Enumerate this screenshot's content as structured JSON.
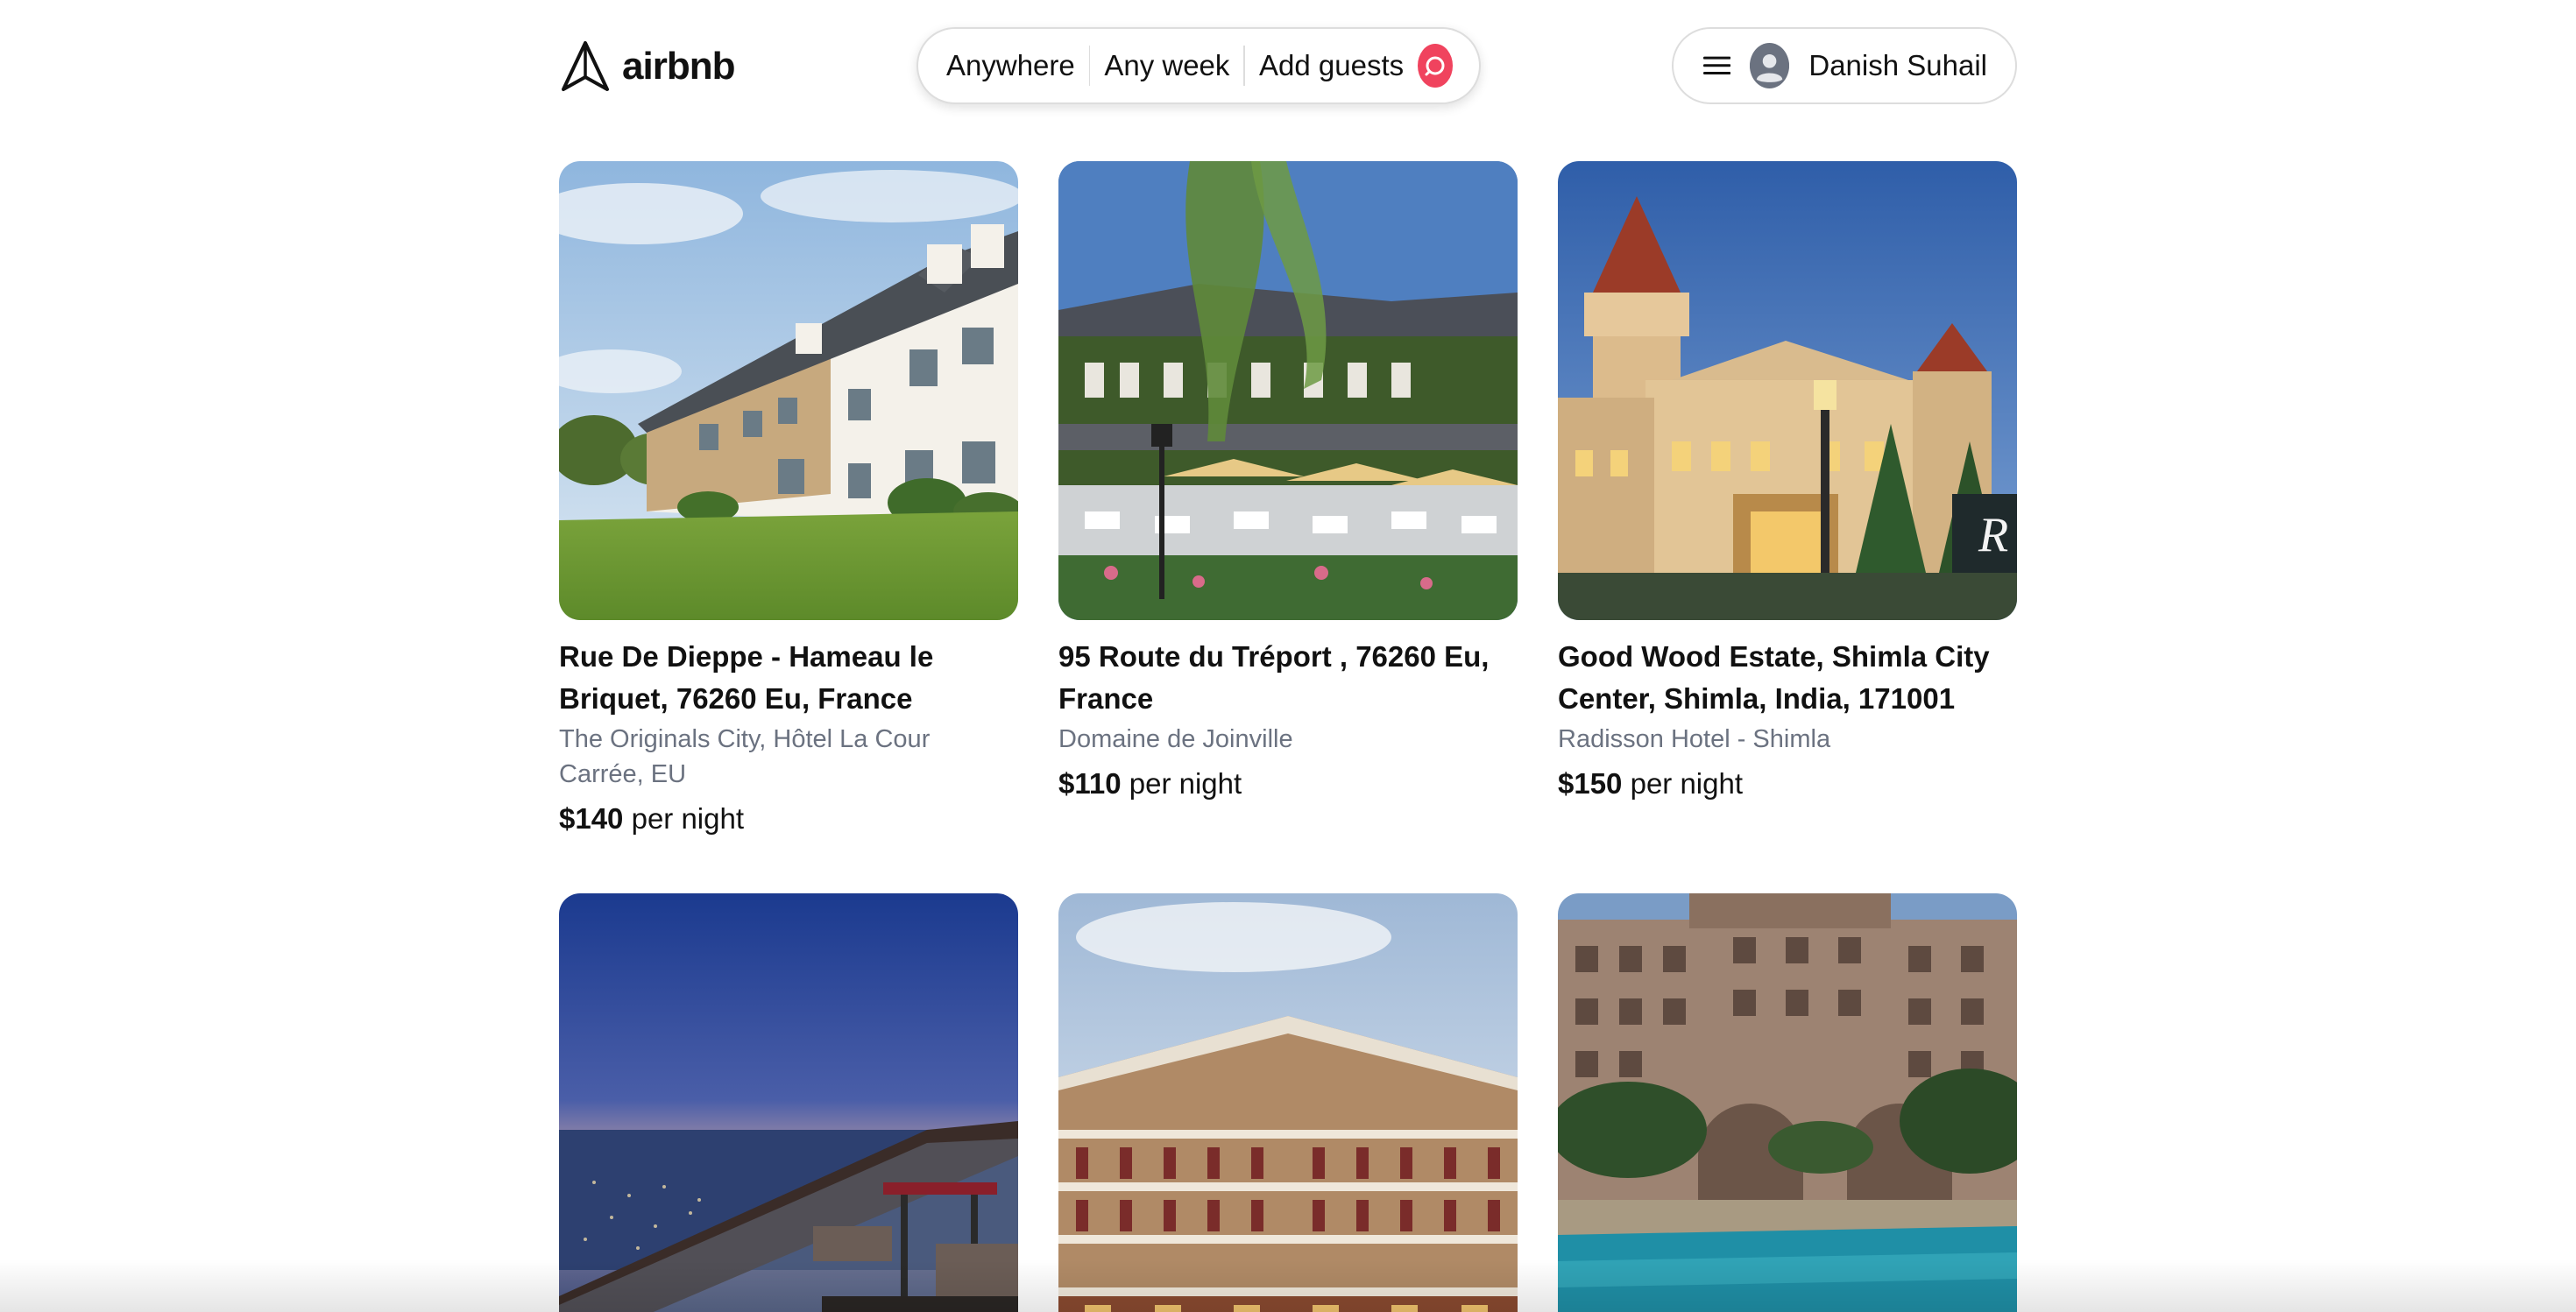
{
  "header": {
    "logo_text": "airbnb",
    "logo_icon": "paper-plane-icon",
    "search": {
      "location": "Anywhere",
      "dates": "Any week",
      "guests": "Add guests",
      "search_icon": "search-icon"
    },
    "user": {
      "menu_icon": "hamburger-menu-icon",
      "avatar_icon": "user-avatar-icon",
      "name": "Danish Suhail"
    }
  },
  "listings": [
    {
      "title": "Rue De Dieppe - Hameau le Briquet, 76260 Eu, France",
      "subtitle": "The Originals City, Hôtel La Cour Carrée, EU",
      "price": "$140",
      "price_suffix": " per night"
    },
    {
      "title": "95 Route du Tréport , 76260 Eu, France",
      "subtitle": "Domaine de Joinville",
      "price": "$110",
      "price_suffix": " per night"
    },
    {
      "title": "Good Wood Estate, Shimla City Center, Shimla, India, 171001",
      "subtitle": "Radisson Hotel - Shimla",
      "price": "$150",
      "price_suffix": " per night"
    },
    {
      "title": "",
      "subtitle": "",
      "price": "",
      "price_suffix": ""
    },
    {
      "title": "",
      "subtitle": "",
      "price": "",
      "price_suffix": ""
    },
    {
      "title": "",
      "subtitle": "",
      "price": "",
      "price_suffix": ""
    }
  ],
  "colors": {
    "accent": "#f0435e",
    "border": "#dddddd",
    "muted_text": "#6b7280"
  }
}
